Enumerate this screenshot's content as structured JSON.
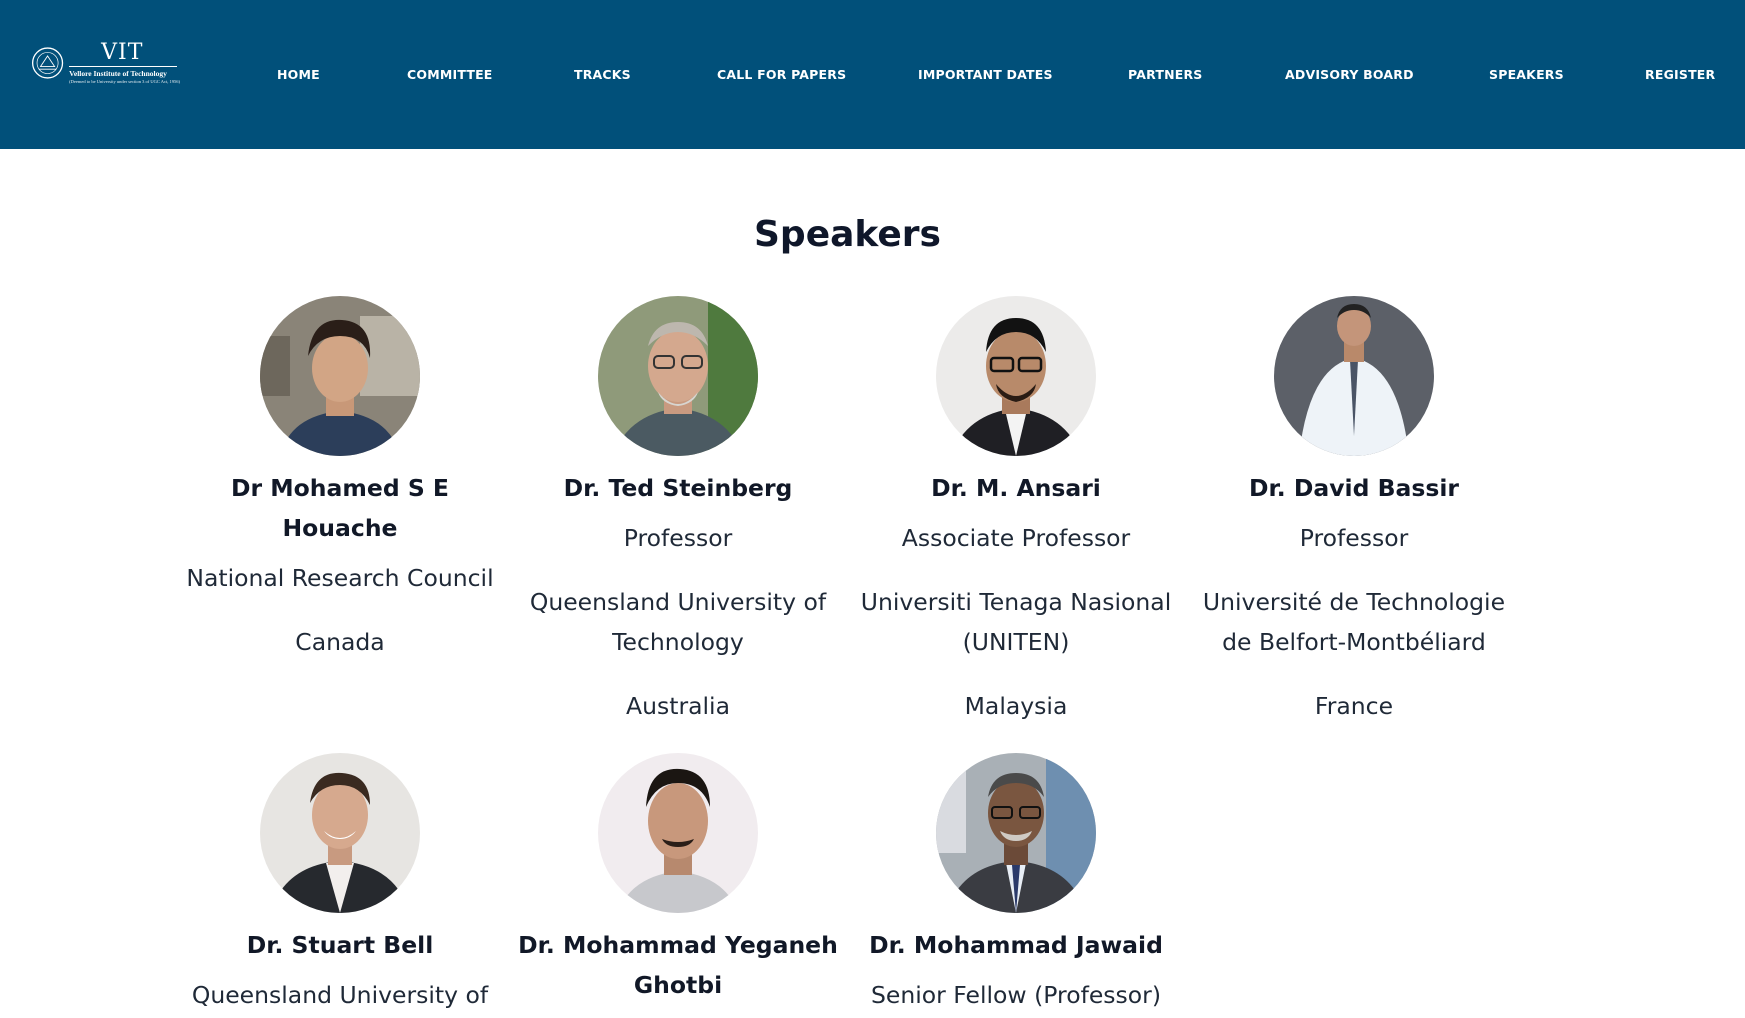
{
  "logo": {
    "abbr": "VIT",
    "full_name": "Vellore Institute of Technology",
    "sub": "(Deemed to be University under section 3 of UGC Act, 1956)"
  },
  "nav": {
    "items": [
      "HOME",
      "COMMITTEE",
      "TRACKS",
      "CALL FOR PAPERS",
      "IMPORTANT DATES",
      "PARTNERS",
      "ADVISORY BOARD",
      "SPEAKERS",
      "REGISTER"
    ]
  },
  "page": {
    "title": "Speakers"
  },
  "speakers": [
    {
      "name": "Dr Mohamed S E Houache",
      "role": "National Research Council",
      "institution": "Canada",
      "country": ""
    },
    {
      "name": "Dr. Ted Steinberg",
      "role": "Professor",
      "institution": "Queensland University of Technology",
      "country": "Australia"
    },
    {
      "name": "Dr. M. Ansari",
      "role": "Associate Professor",
      "institution": "Universiti Tenaga Nasional (UNITEN)",
      "country": "Malaysia"
    },
    {
      "name": "Dr. David Bassir",
      "role": "Professor",
      "institution": "Université de Technologie de Belfort-Montbéliard",
      "country": "France"
    },
    {
      "name": "Dr. Stuart Bell",
      "role": "Queensland University of",
      "institution": "",
      "country": ""
    },
    {
      "name": "Dr. Mohammad Yeganeh Ghotbi",
      "role": "",
      "institution": "",
      "country": ""
    },
    {
      "name": "Dr. Mohammad Jawaid",
      "role": "Senior Fellow (Professor)",
      "institution": "",
      "country": ""
    }
  ],
  "colors": {
    "nav_bg": "#01507a",
    "heading": "#0f172a"
  }
}
